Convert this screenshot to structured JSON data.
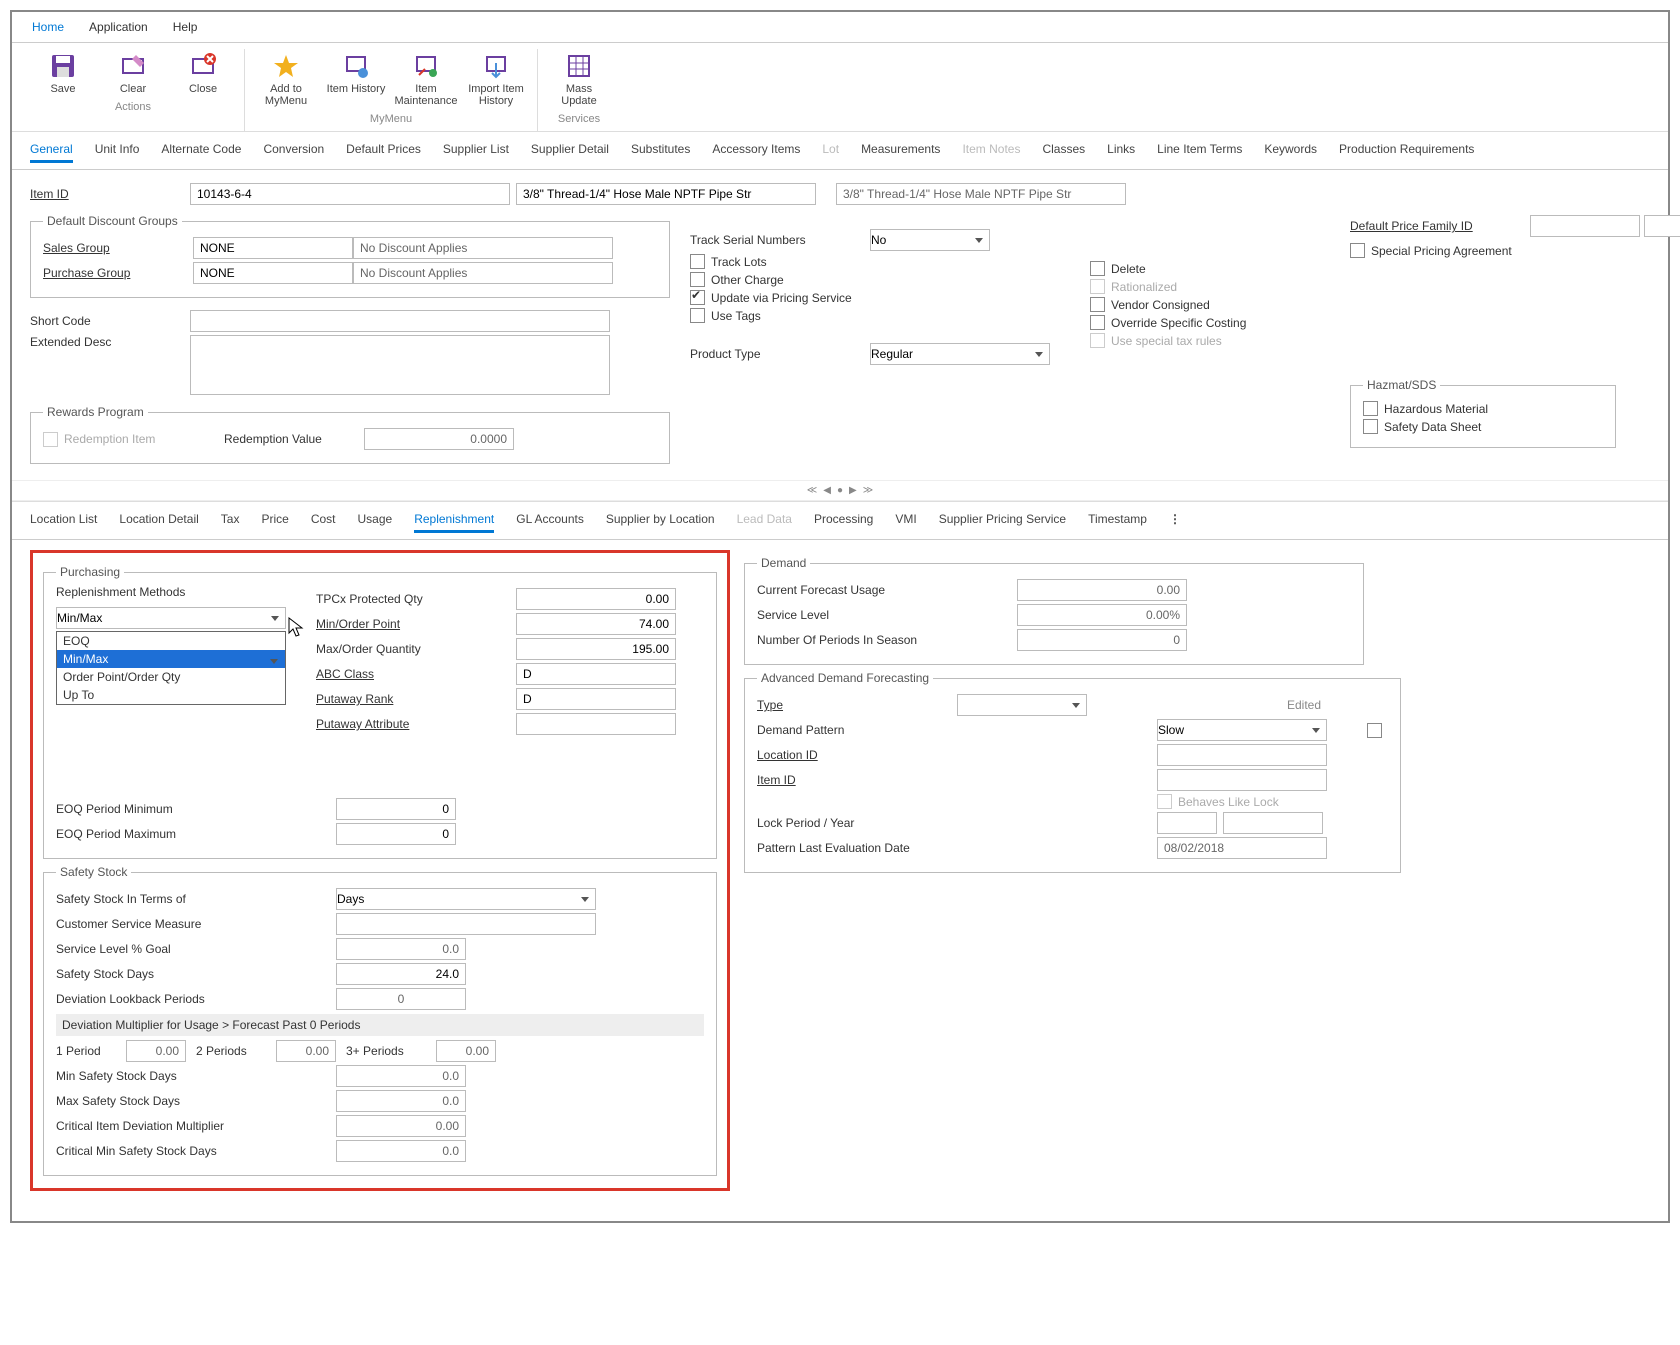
{
  "menu": {
    "home": "Home",
    "application": "Application",
    "help": "Help"
  },
  "ribbon": {
    "actions": {
      "label": "Actions",
      "save": "Save",
      "clear": "Clear",
      "close": "Close"
    },
    "mymenu": {
      "label": "MyMenu",
      "add": "Add to MyMenu",
      "itemHist": "Item History",
      "itemMaint": "Item Maintenance",
      "importHist": "Import Item History"
    },
    "services": {
      "label": "Services",
      "mass": "Mass Update"
    }
  },
  "topTabs": [
    "General",
    "Unit Info",
    "Alternate Code",
    "Conversion",
    "Default Prices",
    "Supplier List",
    "Supplier Detail",
    "Substitutes",
    "Accessory Items",
    "Lot",
    "Measurements",
    "Item Notes",
    "Classes",
    "Links",
    "Line Item Terms",
    "Keywords",
    "Production Requirements"
  ],
  "topTabsDisabled": [
    "Lot",
    "Item Notes"
  ],
  "itemId": {
    "label": "Item ID",
    "value": "10143-6-4",
    "desc1": "3/8\" Thread-1/4\" Hose Male NPTF Pipe Str",
    "desc2": "3/8\" Thread-1/4\" Hose Male NPTF Pipe Str"
  },
  "discount": {
    "legend": "Default Discount Groups",
    "salesLabel": "Sales Group",
    "salesVal": "NONE",
    "salesDesc": "No Discount Applies",
    "purchLabel": "Purchase Group",
    "purchVal": "NONE",
    "purchDesc": "No Discount Applies"
  },
  "general": {
    "shortCode": "Short Code",
    "extDesc": "Extended Desc",
    "trackSerial": "Track Serial Numbers",
    "trackSerialVal": "No",
    "trackLots": "Track Lots",
    "otherCharge": "Other Charge",
    "updatePricing": "Update via Pricing Service",
    "useTags": "Use Tags",
    "productType": "Product Type",
    "productTypeVal": "Regular",
    "delete": "Delete",
    "rationalized": "Rationalized",
    "vendor": "Vendor Consigned",
    "override": "Override Specific Costing",
    "taxRules": "Use special tax rules",
    "priceFamily": "Default Price Family ID",
    "specialPricing": "Special Pricing Agreement"
  },
  "rewards": {
    "legend": "Rewards Program",
    "redemptionItem": "Redemption Item",
    "redemptionValue": "Redemption Value",
    "value": "0.0000"
  },
  "hazmat": {
    "legend": "Hazmat/SDS",
    "hazardous": "Hazardous Material",
    "sds": "Safety Data Sheet"
  },
  "pager": {
    "prev2": "≪",
    "prev": "◀",
    "dot": "●",
    "next": "▶",
    "next2": "≫"
  },
  "subTabs": [
    "Location List",
    "Location Detail",
    "Tax",
    "Price",
    "Cost",
    "Usage",
    "Replenishment",
    "GL Accounts",
    "Supplier by Location",
    "Lead Data",
    "Processing",
    "VMI",
    "Supplier Pricing Service",
    "Timestamp"
  ],
  "subTabsDisabled": [
    "Lead Data"
  ],
  "purchasing": {
    "legend": "Purchasing",
    "replenLabel": "Replenishment Methods",
    "replenVal": "Min/Max",
    "replenOpts": [
      "EOQ",
      "Min/Max",
      "Order Point/Order Qty",
      "Up To"
    ],
    "tpcx": "TPCx Protected Qty",
    "tpcxVal": "0.00",
    "minOP": "Min/Order Point",
    "minOPVal": "74.00",
    "maxOQ": "Max/Order Quantity",
    "maxOQVal": "195.00",
    "abc": "ABC Class",
    "abcVal": "D",
    "putRank": "Putaway Rank",
    "putRankVal": "D",
    "putAttr": "Putaway Attribute",
    "putAttrVal": "",
    "eoqMin": "EOQ Period Minimum",
    "eoqMinVal": "0",
    "eoqMax": "EOQ Period Maximum",
    "eoqMaxVal": "0"
  },
  "safety": {
    "legend": "Safety Stock",
    "terms": "Safety Stock In Terms of",
    "termsVal": "Days",
    "csm": "Customer Service Measure",
    "slGoal": "Service Level % Goal",
    "slGoalVal": "0.0",
    "ssDays": "Safety Stock Days",
    "ssDaysVal": "24.0",
    "devLook": "Deviation Lookback Periods",
    "devLookVal": "0",
    "devMultHeader": "Deviation Multiplier for Usage > Forecast Past 0 Periods",
    "p1": "1 Period",
    "p1v": "0.00",
    "p2": "2 Periods",
    "p2v": "0.00",
    "p3": "3+ Periods",
    "p3v": "0.00",
    "minSS": "Min Safety Stock Days",
    "minSSVal": "0.0",
    "maxSS": "Max Safety Stock Days",
    "maxSSVal": "0.0",
    "critMult": "Critical Item Deviation Multiplier",
    "critMultVal": "0.00",
    "critMin": "Critical Min Safety Stock Days",
    "critMinVal": "0.0"
  },
  "demand": {
    "legend": "Demand",
    "forecast": "Current Forecast Usage",
    "forecastVal": "0.00",
    "service": "Service Level",
    "serviceVal": "0.00%",
    "periods": "Number Of Periods In Season",
    "periodsVal": "0"
  },
  "adf": {
    "legend": "Advanced Demand Forecasting",
    "type": "Type",
    "typeVal": "",
    "pattern": "Demand Pattern",
    "patternVal": "Slow",
    "location": "Location ID",
    "item": "Item ID",
    "behaves": "Behaves Like Lock",
    "edited": "Edited",
    "lockPeriod": "Lock Period / Year",
    "lastEval": "Pattern Last Evaluation Date",
    "lastEvalVal": "08/02/2018"
  }
}
